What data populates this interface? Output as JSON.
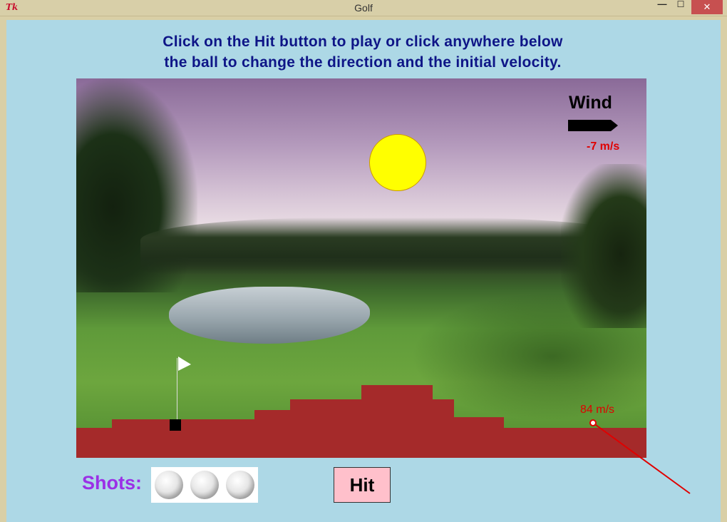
{
  "window": {
    "title": "Golf",
    "app_icon": "tk-feather-icon",
    "app_icon_text": "Tk",
    "controls": {
      "minimize": "—",
      "maximize": "☐",
      "close": "✕"
    }
  },
  "instructions": {
    "line1": "Click on the Hit button to play or click anywhere below",
    "line2": "the ball to change the direction and the initial velocity."
  },
  "wind": {
    "label": "Wind",
    "speed": "-7  m/s",
    "arrow_direction": "right"
  },
  "ball": {
    "velocity_label": "84 m/s"
  },
  "shots": {
    "label": "Shots:",
    "remaining": 3,
    "ball_icon": "golf-ball-icon"
  },
  "hit_button": {
    "label": "Hit"
  },
  "colors": {
    "background": "#add8e6",
    "instruction_text": "#0e1587",
    "ground": "#a52a2a",
    "sun": "#ffff00",
    "wind_speed": "#e00000",
    "shots_label": "#9b30e6",
    "hit_button": "#ffc0cb"
  }
}
